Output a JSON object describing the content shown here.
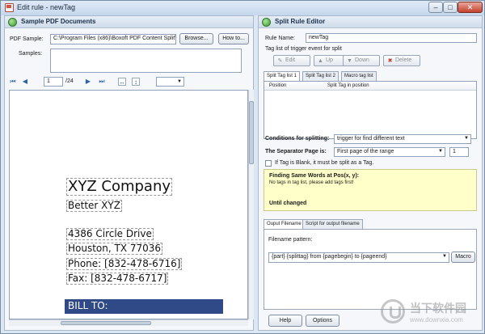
{
  "window": {
    "title": "Edit rule - newTag",
    "minimize_label": "–",
    "maximize_label": "□",
    "close_label": "✕"
  },
  "left_pane": {
    "title": "Sample PDF Documents",
    "pdf_sample_label": "PDF Sample:",
    "pdf_sample_value": "C:\\Program Files (x86)\\Boxoft PDF Content Split\\de",
    "browse_label": "Browse...",
    "howto_label": "How to...",
    "samples_label": "Samples:",
    "samples_value": "",
    "nav": {
      "first_icon": "first-page-icon",
      "prev_icon": "prev-page-icon",
      "page_value": "1",
      "page_total": "/24",
      "next_icon": "next-page-icon",
      "last_icon": "last-page-icon",
      "fit_width_icon": "fit-width-icon",
      "fit_page_icon": "fit-page-icon",
      "zoom_value": ""
    },
    "document": {
      "company": "XYZ Company",
      "subtitle": "Better XYZ",
      "address1": "4386 Circle Drive",
      "address2": "Houston, TX 77036",
      "phone": "Phone: [832-478-6716]",
      "fax": "Fax: [832-478-6717]",
      "bill_to": "BILL TO:"
    }
  },
  "right_pane": {
    "title": "Split Rule Editor",
    "rule_name_label": "Rule Name:",
    "rule_name_value": "newTag",
    "tag_list_caption": "Tag list of trigger event for split",
    "toolbar": {
      "edit_label": "Edit",
      "up_label": "Up",
      "down_label": "Down",
      "delete_label": "Delete"
    },
    "tabs": [
      "Split Tag list 1",
      "Split Tag list 2",
      "Macro tag list"
    ],
    "grid_headers": [
      "Position",
      "Split Tag in position"
    ],
    "conditions_label": "Conditions for splitting:",
    "conditions_value": "trigger for find different text",
    "separator_label": "The Separator Page is:",
    "separator_value": "First page of the range",
    "separator_number": "1",
    "blank_tag_label": "If Tag is Blank, it must be split as a Tag.",
    "info": {
      "heading": "Finding Same Words at Pos(x, y):",
      "message": "No tags in tag list, please add tags first!",
      "footer": "Until changed"
    },
    "output_tabs": [
      "Ouput Filename",
      "Script for output filename"
    ],
    "filename_pattern_label": "Filename pattern:",
    "filename_pattern_value": "{part} {splittag} from {pagebegin} to {pageend}",
    "macro_label": "Macro",
    "help_label": "Help",
    "options_label": "Options"
  },
  "watermark": {
    "text": "当下软件园",
    "url": "www.downxia.com"
  }
}
